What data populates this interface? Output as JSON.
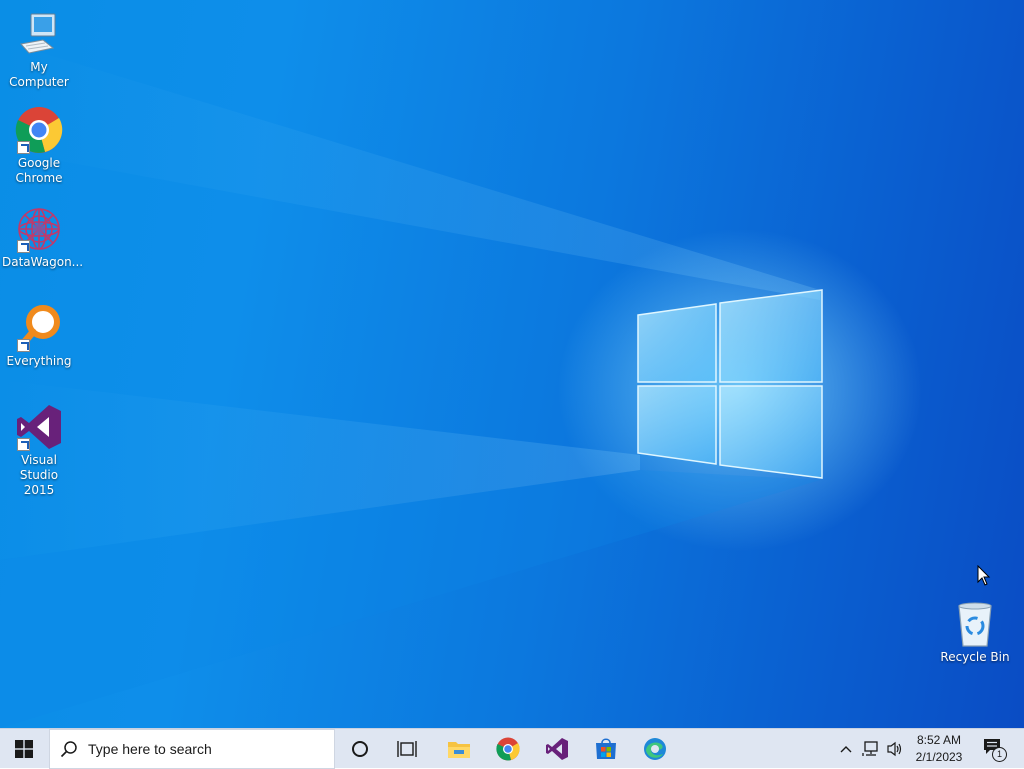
{
  "desktop": {
    "icons": [
      {
        "label": "My Computer",
        "icon": "computer-icon",
        "shortcut": false
      },
      {
        "label": "Google\nChrome",
        "icon": "chrome-icon",
        "shortcut": true
      },
      {
        "label": "DataWagon...",
        "icon": "datawagon-icon",
        "shortcut": true
      },
      {
        "label": "Everything",
        "icon": "everything-icon",
        "shortcut": true
      },
      {
        "label": "Visual Studio\n2015",
        "icon": "visual-studio-icon",
        "shortcut": true
      },
      {
        "label": "Recycle Bin",
        "icon": "recycle-bin-icon",
        "shortcut": false
      }
    ]
  },
  "taskbar": {
    "search_placeholder": "Type here to search",
    "pinned": [
      "cortana-icon",
      "task-view-icon",
      "file-explorer-icon",
      "chrome-icon",
      "visual-studio-icon",
      "store-icon",
      "edge-icon"
    ],
    "clock": {
      "time": "8:52 AM",
      "date": "2/1/2023"
    },
    "notification_count": "1"
  },
  "colors": {
    "taskbar": "#dfe6f2",
    "desktop": "#0a7fe0",
    "vs_purple": "#68217a"
  }
}
